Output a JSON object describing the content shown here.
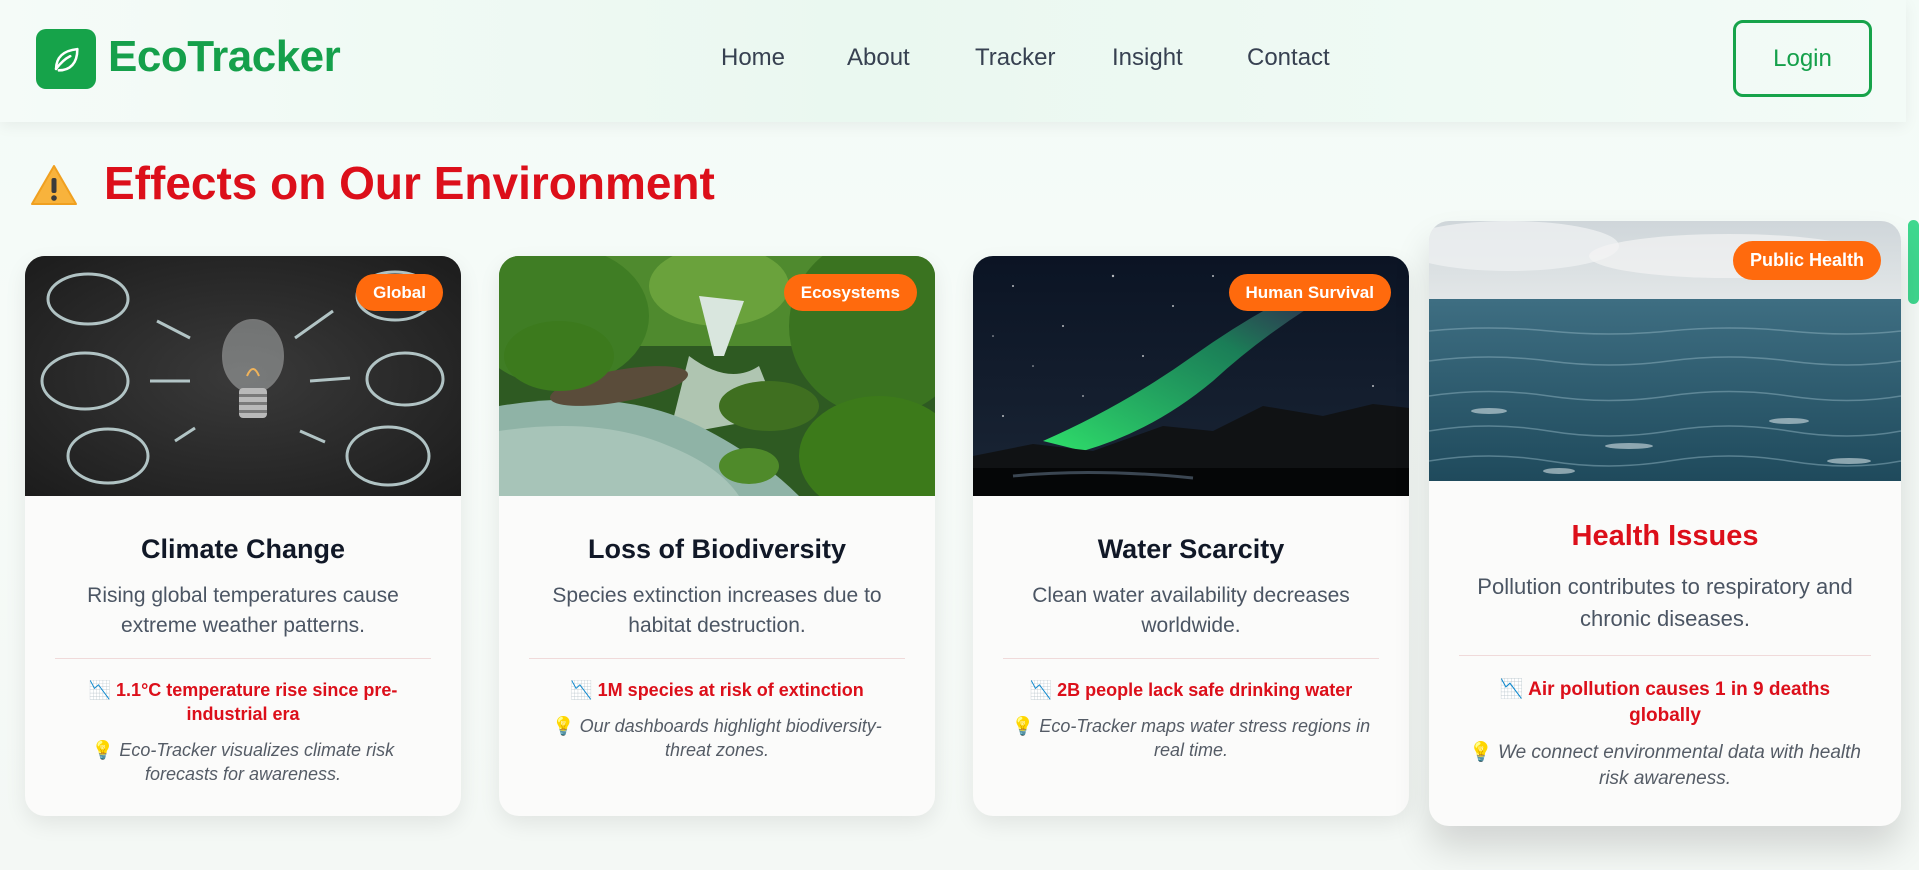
{
  "header": {
    "brand": "EcoTracker",
    "nav": [
      "Home",
      "About",
      "Tracker",
      "Insight",
      "Contact"
    ],
    "login_label": "Login",
    "logo_icon": "leaf-icon",
    "brand_color": "#16a34a"
  },
  "section": {
    "title": "Effects on Our Environment",
    "icon": "warning-icon",
    "title_color": "#dc0f1a"
  },
  "cards": [
    {
      "badge": "Global",
      "title": "Climate Change",
      "description": "Rising global temperatures cause extreme weather patterns.",
      "stat": "1.1°C temperature rise since pre-industrial era",
      "note": "Eco-Tracker visualizes climate risk forecasts for awareness.",
      "image": "lightbulb-chalkboard-image"
    },
    {
      "badge": "Ecosystems",
      "title": "Loss of Biodiversity",
      "description": "Species extinction increases due to habitat destruction.",
      "stat": "1M species at risk of extinction",
      "note": "Our dashboards highlight biodiversity-threat zones.",
      "image": "forest-waterfall-image"
    },
    {
      "badge": "Human Survival",
      "title": "Water Scarcity",
      "description": "Clean water availability decreases worldwide.",
      "stat": "2B people lack safe drinking water",
      "note": "Eco-Tracker maps water stress regions in real time.",
      "image": "aurora-night-image"
    },
    {
      "badge": "Public Health",
      "title": "Health Issues",
      "description": "Pollution contributes to respiratory and chronic diseases.",
      "stat": "Air pollution causes 1 in 9 deaths globally",
      "note": "We connect environmental data with health risk awareness.",
      "image": "ocean-image",
      "hovered": true
    }
  ],
  "icons": {
    "stat": "chart-down-icon",
    "note": "lightbulb-icon"
  },
  "colors": {
    "accent": "#16a34a",
    "badge": "#ff6a0d",
    "stat": "#dc0f1a"
  }
}
